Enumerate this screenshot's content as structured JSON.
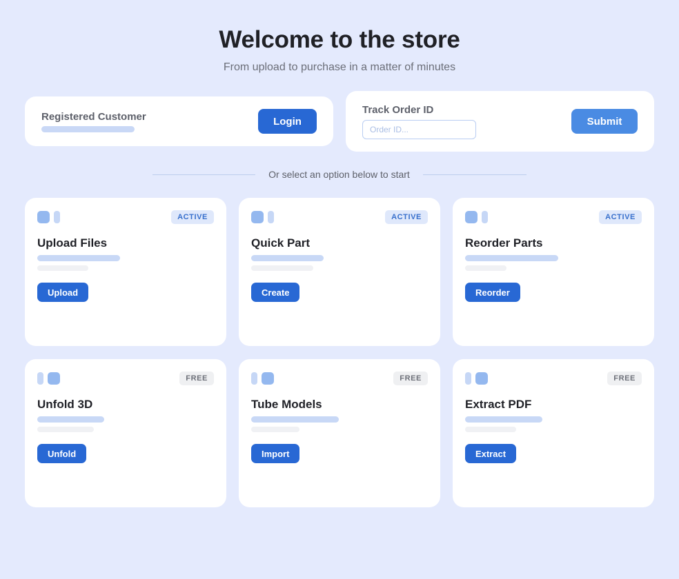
{
  "header": {
    "title": "Welcome to the store",
    "subtitle": "From upload to purchase in a matter of minutes"
  },
  "login_panel": {
    "label": "Registered Customer",
    "button_label": "Login"
  },
  "track_panel": {
    "label": "Track Order ID",
    "input_value": "",
    "input_placeholder": "Order ID...",
    "button_label": "Submit"
  },
  "divider_text": "Or select an option below to start",
  "cards": [
    {
      "title": "Upload Files",
      "badge": "ACTIVE",
      "button_label": "Upload"
    },
    {
      "title": "Quick Part",
      "badge": "ACTIVE",
      "button_label": "Create"
    },
    {
      "title": "Reorder Parts",
      "badge": "ACTIVE",
      "button_label": "Reorder"
    },
    {
      "title": "Unfold 3D",
      "badge": "FREE",
      "button_label": "Unfold"
    },
    {
      "title": "Tube Models",
      "badge": "FREE",
      "button_label": "Import"
    },
    {
      "title": "Extract PDF",
      "badge": "FREE",
      "button_label": "Extract"
    }
  ],
  "colors": {
    "background": "#e4eafd",
    "primary_button": "#2868d4",
    "submit_button": "#4a8be3",
    "active_badge_text": "#3870cc",
    "skeleton": "#c8d8f6"
  }
}
